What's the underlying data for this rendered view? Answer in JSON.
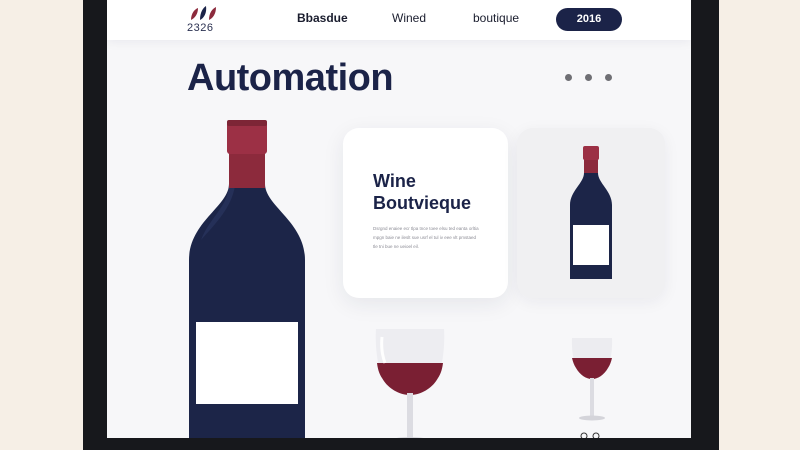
{
  "brand": {
    "logo_text": "2326"
  },
  "nav": {
    "items": [
      "Bbasdue",
      "Wined",
      "boutique"
    ],
    "year_button": "2016"
  },
  "hero": {
    "title": "Automation"
  },
  "card": {
    "title_line1": "Wine",
    "title_line2": "Boutvieque",
    "body": "Dsrgnd enaiee ecr tlpa tnce toee elsu ted eanta orltia mpgn baie ne ileslt sue usrf el tul iv eee vlt pmstaed tle tni bue ne ueioel eil."
  },
  "colors": {
    "navy": "#1b2348",
    "wine": "#8c2a3c",
    "bottle": "#1c2548"
  }
}
